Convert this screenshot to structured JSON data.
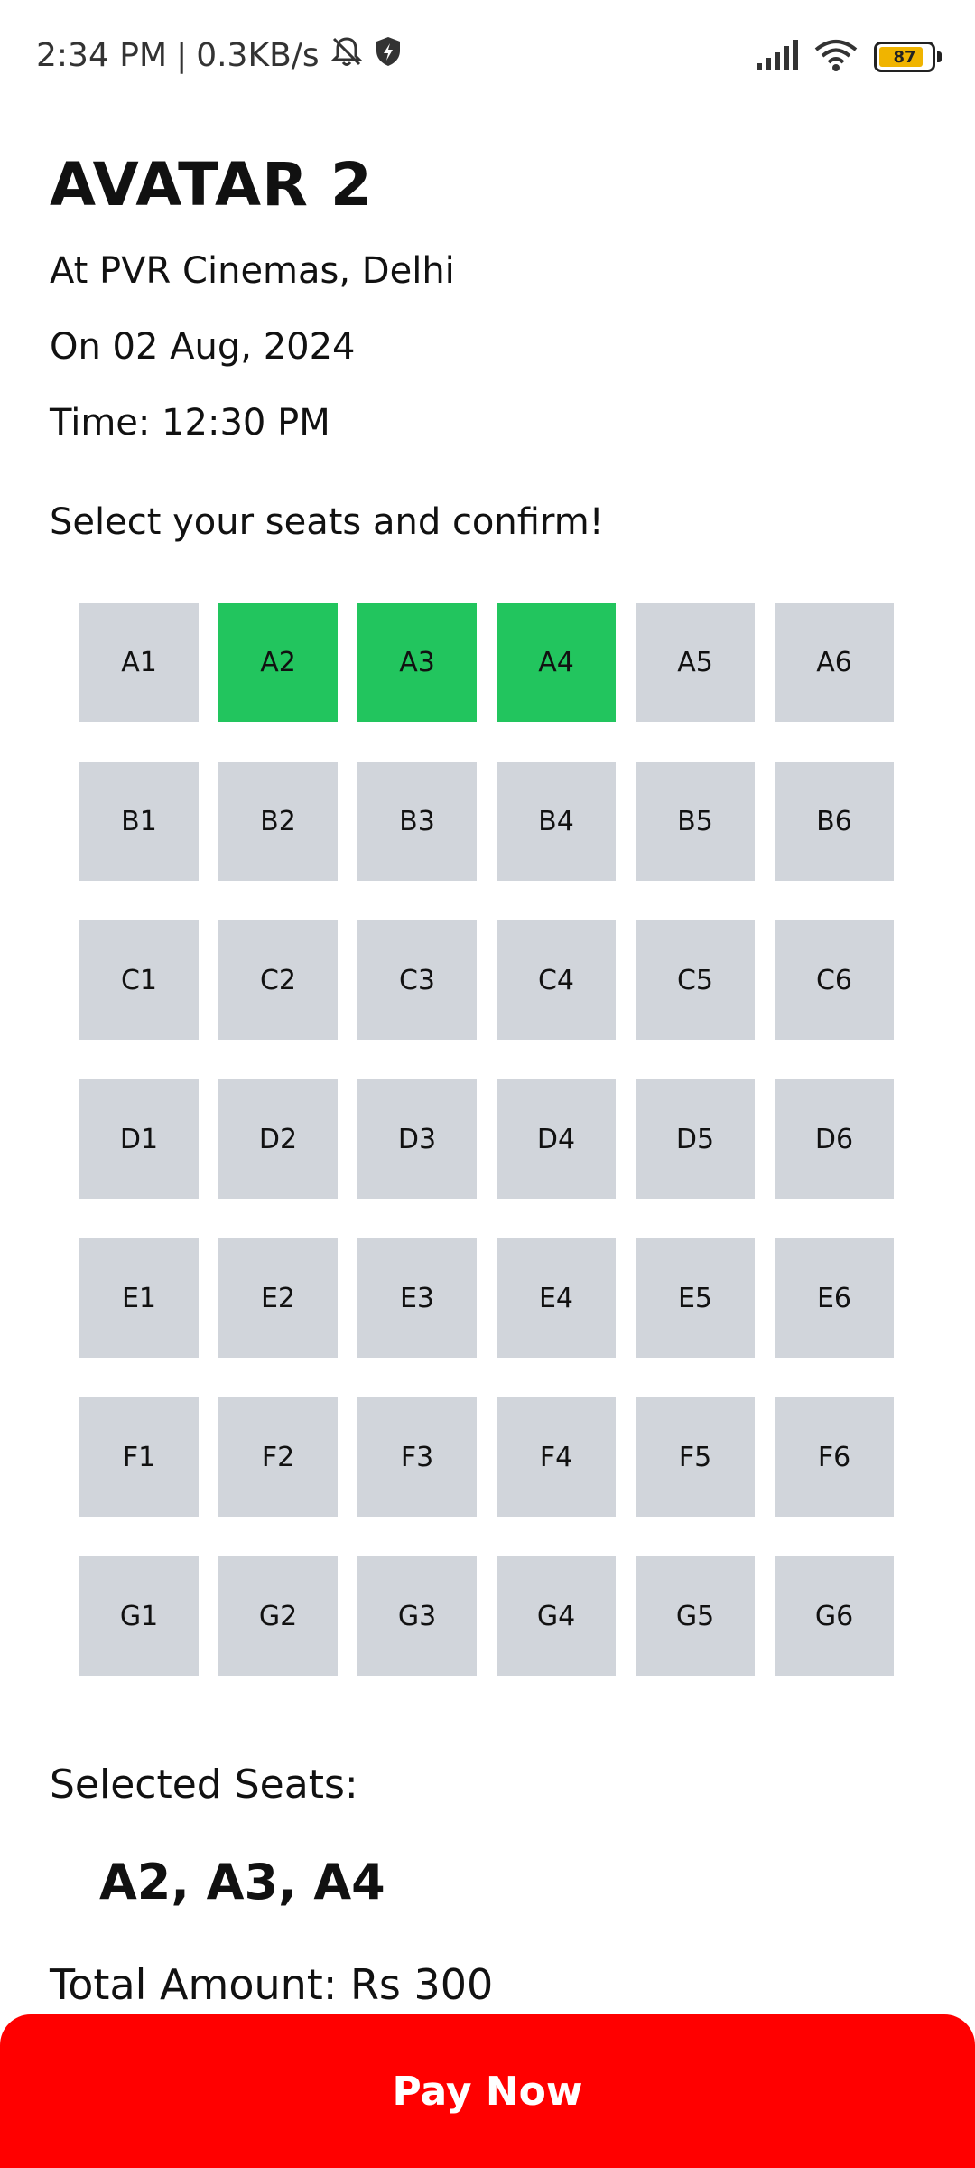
{
  "status_bar": {
    "time": "2:34 PM",
    "separator": "|",
    "speed": "0.3KB/s",
    "battery_level": "87",
    "icons": [
      "mute-notifications-icon",
      "vpn-shield-icon",
      "signal-icon",
      "wifi-icon",
      "battery-icon"
    ]
  },
  "movie": {
    "title": "AVATAR 2",
    "venue": "At PVR Cinemas, Delhi",
    "date": "On 02 Aug, 2024",
    "time": "Time: 12:30 PM"
  },
  "prompt": "Select your seats and confirm!",
  "seats": [
    "A1",
    "A2",
    "A3",
    "A4",
    "A5",
    "A6",
    "B1",
    "B2",
    "B3",
    "B4",
    "B5",
    "B6",
    "C1",
    "C2",
    "C3",
    "C4",
    "C5",
    "C6",
    "D1",
    "D2",
    "D3",
    "D4",
    "D5",
    "D6",
    "E1",
    "E2",
    "E3",
    "E4",
    "E5",
    "E6",
    "F1",
    "F2",
    "F3",
    "F4",
    "F5",
    "F6",
    "G1",
    "G2",
    "G3",
    "G4",
    "G5",
    "G6"
  ],
  "selected_seat_ids": [
    "A2",
    "A3",
    "A4"
  ],
  "selected_label": "Selected Seats:",
  "selected_value": "A2, A3, A4",
  "total": "Total Amount: Rs 300",
  "pay_button_label": "Pay Now",
  "colors": {
    "seat_available": "#d1d5db",
    "seat_selected": "#22c55e",
    "pay_button": "#ff0000"
  }
}
